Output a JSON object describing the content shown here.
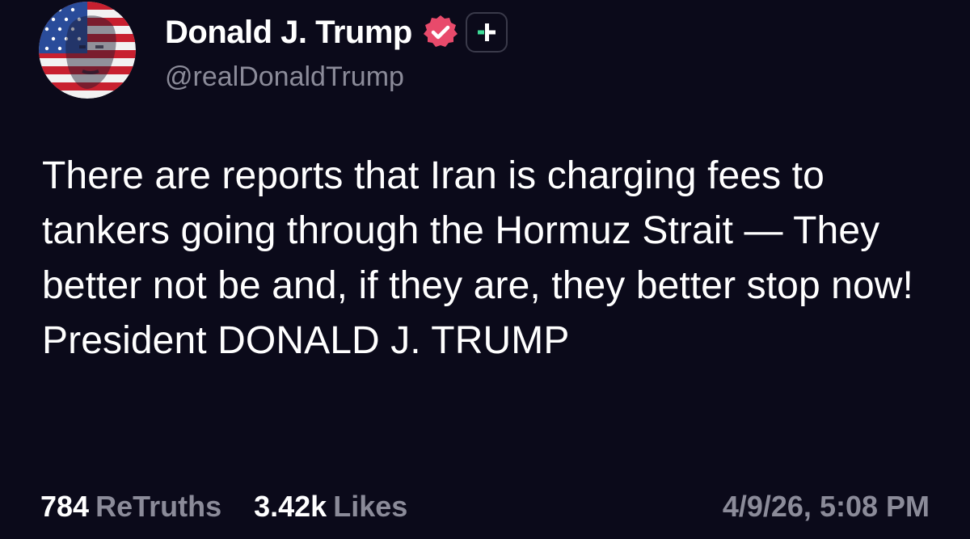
{
  "post": {
    "author": {
      "display_name": "Donald J. Trump",
      "handle": "@realDonaldTrump",
      "avatar_icon": "flag-portrait-avatar",
      "verified_icon": "verified-badge-icon",
      "follow_icon": "plus-icon"
    },
    "text": "There are reports that Iran is charging fees to tankers going through the Hormuz Strait — They better not be and, if they are, they better stop now! President DONALD J. TRUMP",
    "stats": {
      "retruths_count": "784",
      "retruths_label": "ReTruths",
      "likes_count": "3.42k",
      "likes_label": "Likes"
    },
    "timestamp": "4/9/26, 5:08 PM"
  },
  "colors": {
    "background": "#0b0a1a",
    "primary_text": "#ffffff",
    "secondary_text": "#8b8b99",
    "verified_badge": "#e84a6b",
    "follow_accent": "#3ddc97",
    "follow_border": "#3a3a4a"
  }
}
